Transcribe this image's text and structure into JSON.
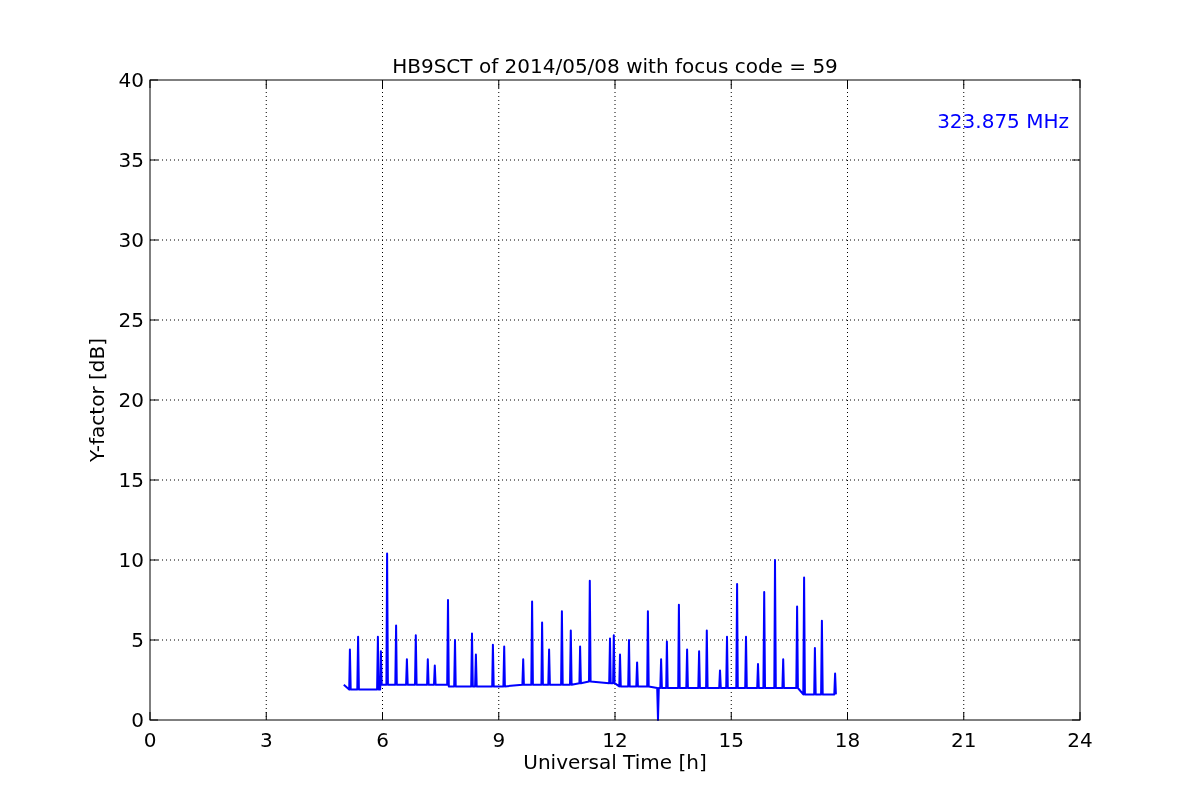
{
  "chart_data": {
    "type": "line",
    "title": "HB9SCT of 2014/05/08 with focus code = 59",
    "xlabel": "Universal Time [h]",
    "ylabel": "Y-factor [dB]",
    "xlim": [
      0,
      24
    ],
    "ylim": [
      0,
      40
    ],
    "xticks": [
      0,
      3,
      6,
      9,
      12,
      15,
      18,
      21,
      24
    ],
    "yticks": [
      0,
      5,
      10,
      15,
      20,
      25,
      30,
      35,
      40
    ],
    "series": [
      {
        "name": "323.875 MHz",
        "color": "#0000ff",
        "x": [
          5.0,
          5.14,
          5.16,
          5.18,
          5.35,
          5.37,
          5.39,
          5.86,
          5.88,
          5.9,
          5.94,
          5.96,
          5.98,
          6.1,
          6.12,
          6.14,
          6.33,
          6.35,
          6.37,
          6.61,
          6.63,
          6.65,
          6.84,
          6.86,
          6.88,
          7.15,
          7.17,
          7.19,
          7.33,
          7.35,
          7.37,
          7.67,
          7.69,
          7.71,
          7.85,
          7.87,
          7.89,
          8.29,
          8.31,
          8.33,
          8.39,
          8.41,
          8.43,
          8.83,
          8.85,
          8.87,
          9.12,
          9.14,
          9.16,
          9.61,
          9.63,
          9.65,
          9.84,
          9.86,
          9.88,
          10.1,
          10.12,
          10.14,
          10.28,
          10.3,
          10.32,
          10.61,
          10.63,
          10.65,
          10.84,
          10.86,
          10.88,
          11.08,
          11.1,
          11.12,
          11.33,
          11.35,
          11.37,
          11.85,
          11.87,
          11.89,
          11.95,
          11.97,
          11.99,
          12.11,
          12.13,
          12.15,
          12.34,
          12.36,
          12.38,
          12.55,
          12.57,
          12.59,
          12.83,
          12.85,
          12.87,
          13.09,
          13.11,
          13.13,
          13.17,
          13.19,
          13.21,
          13.32,
          13.34,
          13.36,
          13.63,
          13.65,
          13.67,
          13.84,
          13.86,
          13.88,
          14.15,
          14.17,
          14.19,
          14.35,
          14.37,
          14.39,
          14.69,
          14.71,
          14.73,
          14.87,
          14.89,
          14.91,
          15.13,
          15.15,
          15.17,
          15.36,
          15.38,
          15.4,
          15.67,
          15.69,
          15.71,
          15.83,
          15.85,
          15.87,
          16.11,
          16.13,
          16.15,
          16.32,
          16.34,
          16.36,
          16.68,
          16.7,
          16.72,
          16.86,
          16.88,
          16.9,
          17.14,
          17.16,
          17.18,
          17.32,
          17.34,
          17.36,
          17.66,
          17.68,
          17.7
        ],
        "values": [
          2.2,
          1.9,
          4.4,
          1.9,
          1.9,
          5.2,
          1.9,
          1.9,
          5.2,
          1.9,
          1.9,
          4.3,
          2.2,
          2.2,
          10.4,
          2.2,
          2.2,
          5.9,
          2.2,
          2.2,
          3.8,
          2.2,
          2.2,
          5.3,
          2.2,
          2.2,
          3.8,
          2.2,
          2.2,
          3.4,
          2.2,
          2.2,
          7.5,
          2.1,
          2.1,
          5.0,
          2.1,
          2.1,
          5.4,
          2.1,
          2.1,
          4.1,
          2.1,
          2.1,
          4.7,
          2.1,
          2.1,
          4.6,
          2.1,
          2.2,
          3.8,
          2.2,
          2.2,
          7.4,
          2.2,
          2.2,
          6.1,
          2.2,
          2.2,
          4.4,
          2.2,
          2.2,
          6.8,
          2.2,
          2.2,
          5.6,
          2.2,
          2.3,
          4.6,
          2.3,
          2.4,
          8.7,
          2.4,
          2.3,
          5.1,
          2.3,
          2.3,
          5.3,
          2.3,
          2.1,
          4.1,
          2.1,
          2.1,
          5.0,
          2.1,
          2.1,
          3.6,
          2.1,
          2.1,
          6.8,
          2.1,
          2.0,
          0.0,
          2.0,
          2.0,
          3.8,
          2.0,
          2.0,
          4.9,
          2.0,
          2.0,
          7.2,
          2.0,
          2.0,
          4.4,
          2.0,
          2.0,
          4.3,
          2.0,
          2.0,
          5.6,
          2.0,
          2.0,
          3.1,
          2.0,
          2.0,
          5.2,
          2.0,
          2.0,
          8.5,
          2.0,
          2.0,
          5.2,
          2.0,
          2.0,
          3.5,
          2.0,
          2.0,
          8.0,
          2.0,
          2.0,
          10.0,
          2.0,
          2.0,
          3.8,
          2.0,
          2.0,
          7.1,
          2.0,
          1.6,
          8.9,
          1.6,
          1.6,
          4.5,
          1.6,
          1.6,
          6.2,
          1.6,
          1.6,
          2.9,
          1.6
        ]
      }
    ],
    "grid": true
  }
}
